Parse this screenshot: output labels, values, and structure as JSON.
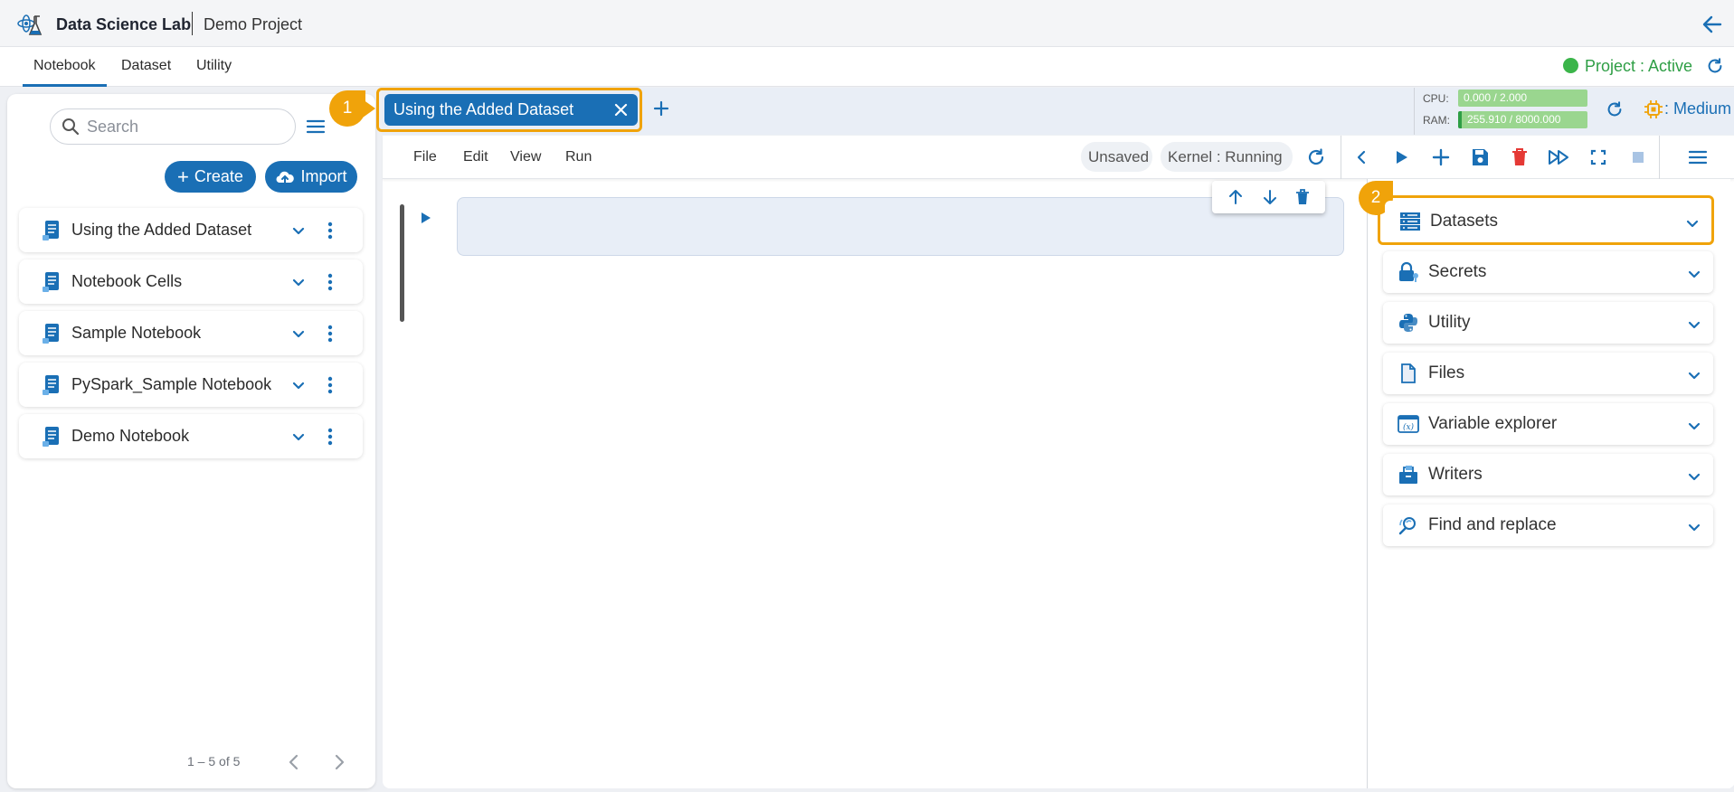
{
  "app": {
    "title": "Data Science Lab",
    "project": "Demo Project"
  },
  "menu_tabs": [
    {
      "label": "Notebook",
      "active": true
    },
    {
      "label": "Dataset",
      "active": false
    },
    {
      "label": "Utility",
      "active": false
    }
  ],
  "project_status": {
    "label": "Project : Active",
    "color": "#3bb54a"
  },
  "search": {
    "placeholder": "Search"
  },
  "actions": {
    "create": "Create",
    "import": "Import"
  },
  "notebooks": [
    {
      "label": "Using the Added Dataset"
    },
    {
      "label": "Notebook Cells"
    },
    {
      "label": "Sample Notebook"
    },
    {
      "label": "PySpark_Sample Notebook"
    },
    {
      "label": "Demo Notebook"
    }
  ],
  "pager": {
    "text": "1 – 5 of 5"
  },
  "editor_tabs": [
    {
      "label": "Using the Added Dataset",
      "active": true
    }
  ],
  "annotations": [
    {
      "label": "1"
    },
    {
      "label": "2"
    }
  ],
  "resources": {
    "cpu_label": "CPU:",
    "cpu_value": "0.000 / 2.000",
    "ram_label": "RAM:",
    "ram_value": "255.910 / 8000.000",
    "size": ": Medium"
  },
  "toolbar": {
    "menus": [
      {
        "label": "File"
      },
      {
        "label": "Edit"
      },
      {
        "label": "View"
      },
      {
        "label": "Run"
      }
    ],
    "save_state": "Unsaved",
    "kernel_status": "Kernel : Running"
  },
  "right_panel": {
    "sections": [
      {
        "label": "Datasets",
        "icon": "datasets-icon",
        "highlighted": true
      },
      {
        "label": "Secrets",
        "icon": "secrets-icon"
      },
      {
        "label": "Utility",
        "icon": "python-icon"
      },
      {
        "label": "Files",
        "icon": "file-icon"
      },
      {
        "label": "Variable explorer",
        "icon": "variable-explorer-icon"
      },
      {
        "label": "Writers",
        "icon": "writers-icon"
      },
      {
        "label": "Find and replace",
        "icon": "find-replace-icon"
      }
    ]
  },
  "colors": {
    "primary": "#1a6fb5",
    "highlight": "#f0a30a",
    "danger": "#e53935",
    "resource_bar": "#9ad68f"
  }
}
